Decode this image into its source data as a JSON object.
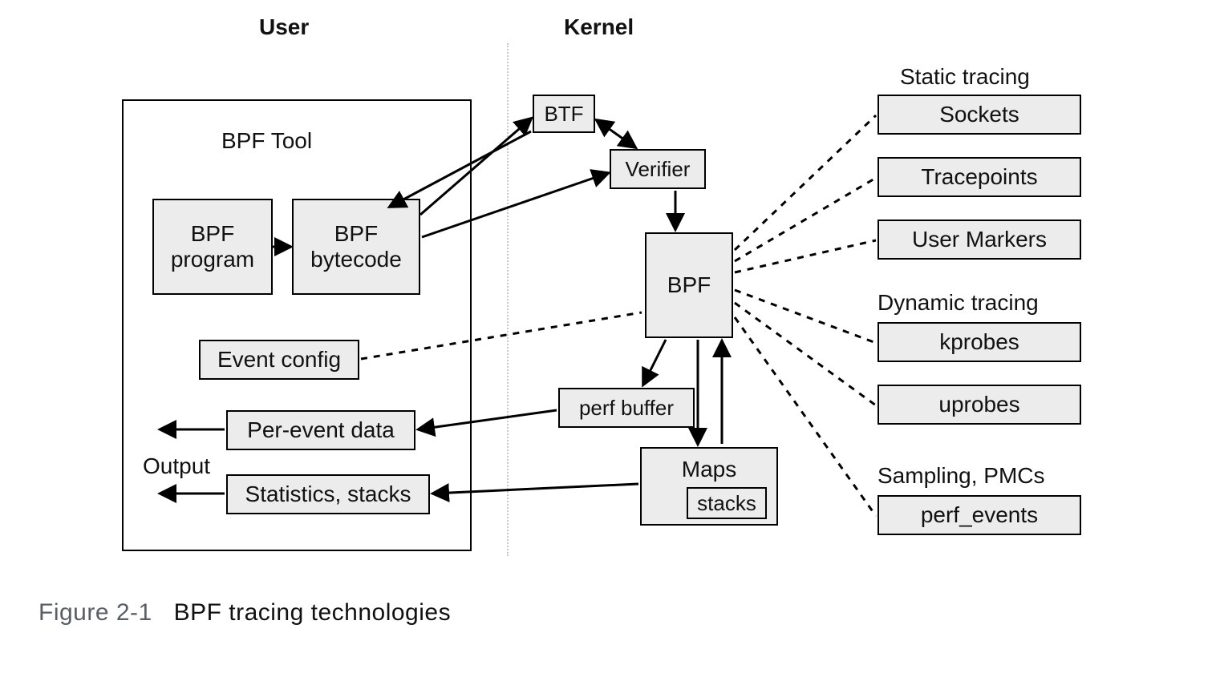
{
  "headers": {
    "user": "User",
    "kernel": "Kernel"
  },
  "user_side": {
    "container_title": "BPF Tool",
    "bpf_program": "BPF\nprogram",
    "bpf_bytecode": "BPF\nbytecode",
    "event_config": "Event config",
    "per_event_data": "Per-event data",
    "statistics_stacks": "Statistics, stacks",
    "output_label": "Output"
  },
  "kernel_side": {
    "btf": "BTF",
    "verifier": "Verifier",
    "bpf": "BPF",
    "perf_buffer": "perf buffer",
    "maps": "Maps",
    "stacks": "stacks"
  },
  "right_column": {
    "static_heading": "Static tracing",
    "sockets": "Sockets",
    "tracepoints": "Tracepoints",
    "user_markers": "User Markers",
    "dynamic_heading": "Dynamic tracing",
    "kprobes": "kprobes",
    "uprobes": "uprobes",
    "sampling_heading": "Sampling, PMCs",
    "perf_events": "perf_events"
  },
  "caption": {
    "prefix": "Figure 2-1",
    "title": "BPF tracing technologies"
  }
}
